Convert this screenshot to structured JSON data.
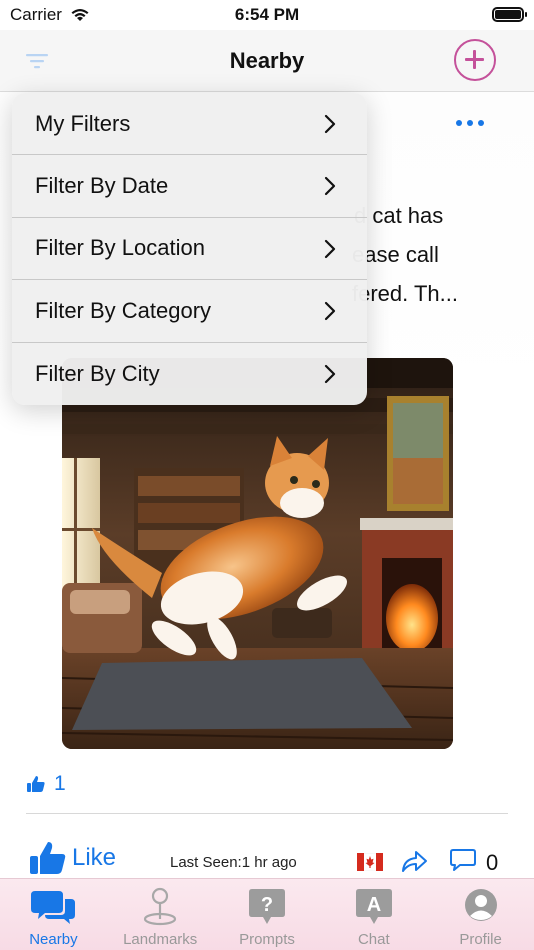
{
  "status_bar": {
    "carrier": "Carrier",
    "time": "6:54 PM"
  },
  "nav": {
    "title": "Nearby"
  },
  "post": {
    "text": "d cat has\nease call\nfered. Th...",
    "likes_count": "1",
    "like_label": "Like",
    "last_seen": "Last Seen:1 hr ago",
    "comment_count": "0"
  },
  "filter_menu": {
    "items": [
      {
        "label": "My Filters"
      },
      {
        "label": "Filter By Date"
      },
      {
        "label": "Filter By Location"
      },
      {
        "label": "Filter By Category"
      },
      {
        "label": "Filter By City"
      }
    ]
  },
  "tab_bar": {
    "tabs": [
      {
        "label": "Nearby",
        "icon": "chat-bubbles-icon",
        "active": true
      },
      {
        "label": "Landmarks",
        "icon": "map-pin-icon",
        "active": false
      },
      {
        "label": "Prompts",
        "icon": "question-bubble-icon",
        "active": false
      },
      {
        "label": "Chat",
        "icon": "letter-a-bubble-icon",
        "active": false
      },
      {
        "label": "Profile",
        "icon": "person-icon",
        "active": false
      }
    ]
  },
  "colors": {
    "accent_blue": "#1877e6",
    "add_button_pink": "#c4519a",
    "tab_bar_pink": "#f7dbe5",
    "inactive_gray": "#999999"
  }
}
